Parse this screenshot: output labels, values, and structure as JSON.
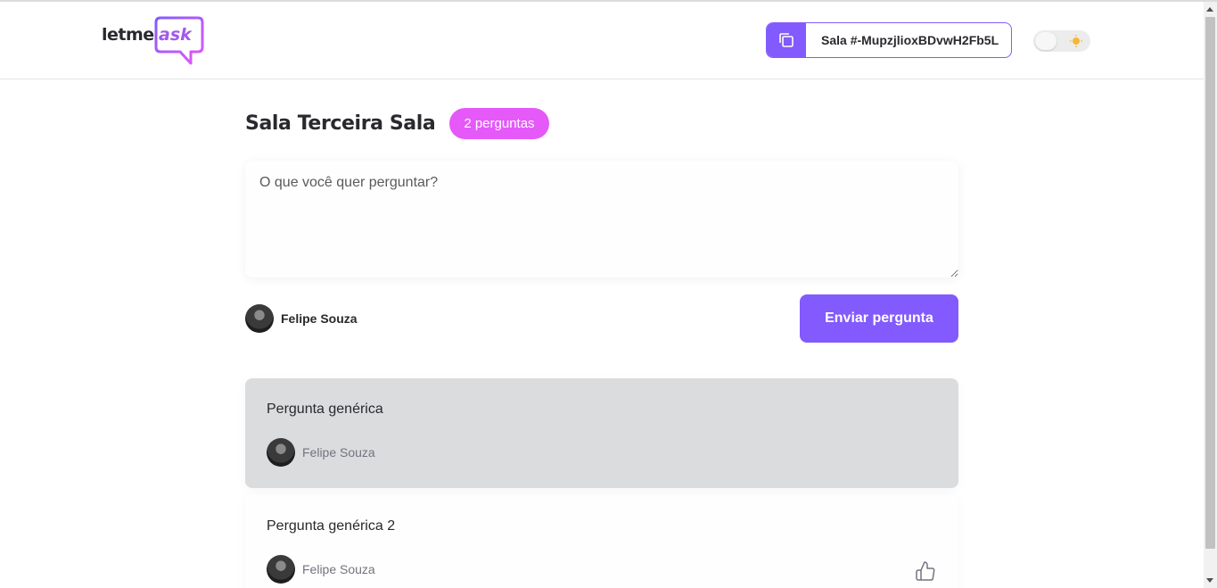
{
  "header": {
    "logo": {
      "text_left": "letme",
      "text_right": "ask"
    },
    "room_code": "Sala #-MupzjlioxBDvwH2Fb5L",
    "theme_toggle": {
      "state": "light"
    }
  },
  "room": {
    "title": "Sala Terceira Sala",
    "question_count": "2 perguntas"
  },
  "form": {
    "placeholder": "O que você quer perguntar?",
    "user_name": "Felipe Souza",
    "send_label": "Enviar pergunta"
  },
  "questions": [
    {
      "content": "Pergunta genérica",
      "author": "Felipe Souza",
      "highlighted": true
    },
    {
      "content": "Pergunta genérica 2",
      "author": "Felipe Souza",
      "highlighted": false
    }
  ],
  "colors": {
    "primary": "#835afd",
    "pink": "#e559f9",
    "highlight_bg": "#dbdcdd",
    "text": "#29292e",
    "muted": "#737380"
  }
}
